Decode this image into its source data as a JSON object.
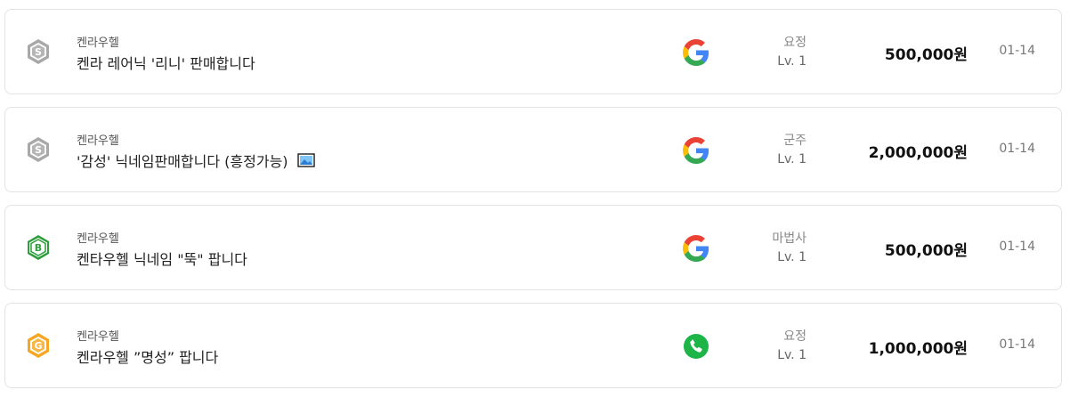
{
  "listings": [
    {
      "grade_icon": "silver-s-badge-icon",
      "grade_letter": "S",
      "grade_color": "#9e9e9e",
      "server": "켄라우헬",
      "title": "켄라 레어닉 '리니' 판매합니다",
      "has_image": false,
      "contact_icon": "google-icon",
      "class_name": "요정",
      "level": "Lv. 1",
      "price": "500,000원",
      "date": "01-14"
    },
    {
      "grade_icon": "silver-s-badge-icon",
      "grade_letter": "S",
      "grade_color": "#9e9e9e",
      "server": "켄라우헬",
      "title": "'감성' 닉네임판매합니다 (흥정가능)",
      "has_image": true,
      "contact_icon": "google-icon",
      "class_name": "군주",
      "level": "Lv. 1",
      "price": "2,000,000원",
      "date": "01-14"
    },
    {
      "grade_icon": "green-b-badge-icon",
      "grade_letter": "B",
      "grade_color": "#2e9e3c",
      "server": "켄라우헬",
      "title": "켄타우헬 닉네임 \"뚝\" 팝니다",
      "has_image": false,
      "contact_icon": "google-icon",
      "class_name": "마법사",
      "level": "Lv. 1",
      "price": "500,000원",
      "date": "01-14"
    },
    {
      "grade_icon": "gold-g-badge-icon",
      "grade_letter": "G",
      "grade_color": "#f5a623",
      "server": "켄라우헬",
      "title": "켄라우헬 ”명성” 팝니다",
      "has_image": false,
      "contact_icon": "phone-icon",
      "class_name": "요정",
      "level": "Lv. 1",
      "price": "1,000,000원",
      "date": "01-14"
    }
  ]
}
